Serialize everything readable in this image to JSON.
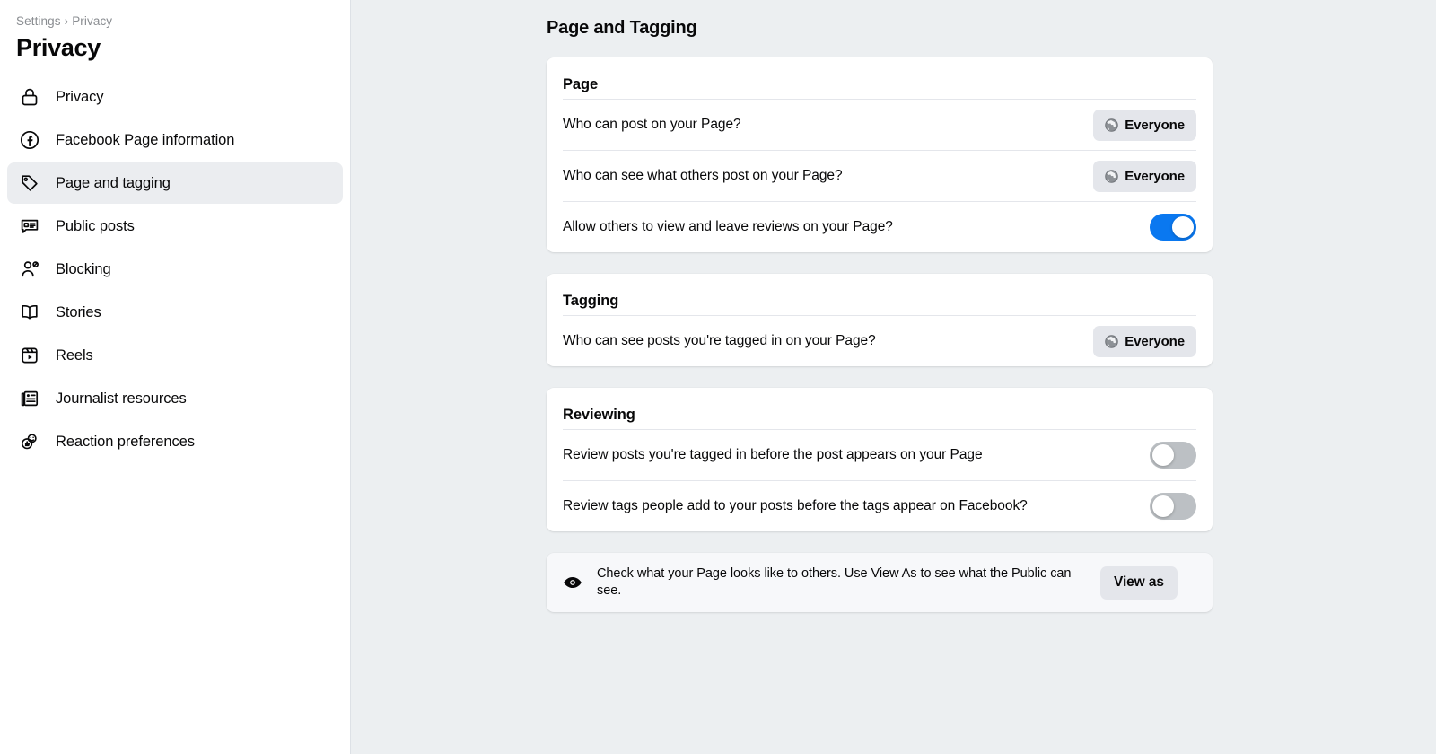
{
  "sidebar": {
    "breadcrumb": {
      "parent": "Settings",
      "separator": "›",
      "current": "Privacy"
    },
    "title": "Privacy",
    "items": [
      {
        "label": "Privacy",
        "icon": "lock-icon",
        "active": false
      },
      {
        "label": "Facebook Page information",
        "icon": "facebook-circle-icon",
        "active": false
      },
      {
        "label": "Page and tagging",
        "icon": "tag-icon",
        "active": true
      },
      {
        "label": "Public posts",
        "icon": "comment-bubble-icon",
        "active": false
      },
      {
        "label": "Blocking",
        "icon": "person-blocked-icon",
        "active": false
      },
      {
        "label": "Stories",
        "icon": "book-icon",
        "active": false
      },
      {
        "label": "Reels",
        "icon": "reels-icon",
        "active": false
      },
      {
        "label": "Journalist resources",
        "icon": "newspaper-icon",
        "active": false
      },
      {
        "label": "Reaction preferences",
        "icon": "reactions-icon",
        "active": false
      }
    ]
  },
  "main": {
    "title": "Page and Tagging",
    "cards": [
      {
        "title": "Page",
        "rows": [
          {
            "label": "Who can post on your Page?",
            "control": "pill",
            "value": "Everyone",
            "icon": "globe-icon"
          },
          {
            "label": "Who can see what others post on your Page?",
            "control": "pill",
            "value": "Everyone",
            "icon": "globe-icon"
          },
          {
            "label": "Allow others to view and leave reviews on your Page?",
            "control": "toggle",
            "state": "on"
          }
        ]
      },
      {
        "title": "Tagging",
        "rows": [
          {
            "label": "Who can see posts you're tagged in on your Page?",
            "control": "pill",
            "value": "Everyone",
            "icon": "globe-icon"
          }
        ]
      },
      {
        "title": "Reviewing",
        "rows": [
          {
            "label": "Review posts you're tagged in before the post appears on your Page",
            "control": "toggle",
            "state": "off"
          },
          {
            "label": "Review tags people add to your posts before the tags appear on Facebook?",
            "control": "toggle",
            "state": "off"
          }
        ]
      }
    ],
    "banner": {
      "icon": "eye-icon",
      "text": "Check what your Page looks like to others. Use View As to see what the Public can see.",
      "button_label": "View as"
    }
  },
  "colors": {
    "accent_blue": "#0a78f0",
    "toggle_off_gray": "#bcc0c4",
    "page_background": "#eceff1",
    "card_background": "#ffffff",
    "banner_background": "#f7f8fa",
    "pill_background": "#e4e6eb",
    "active_nav_background": "#ebedf0"
  }
}
